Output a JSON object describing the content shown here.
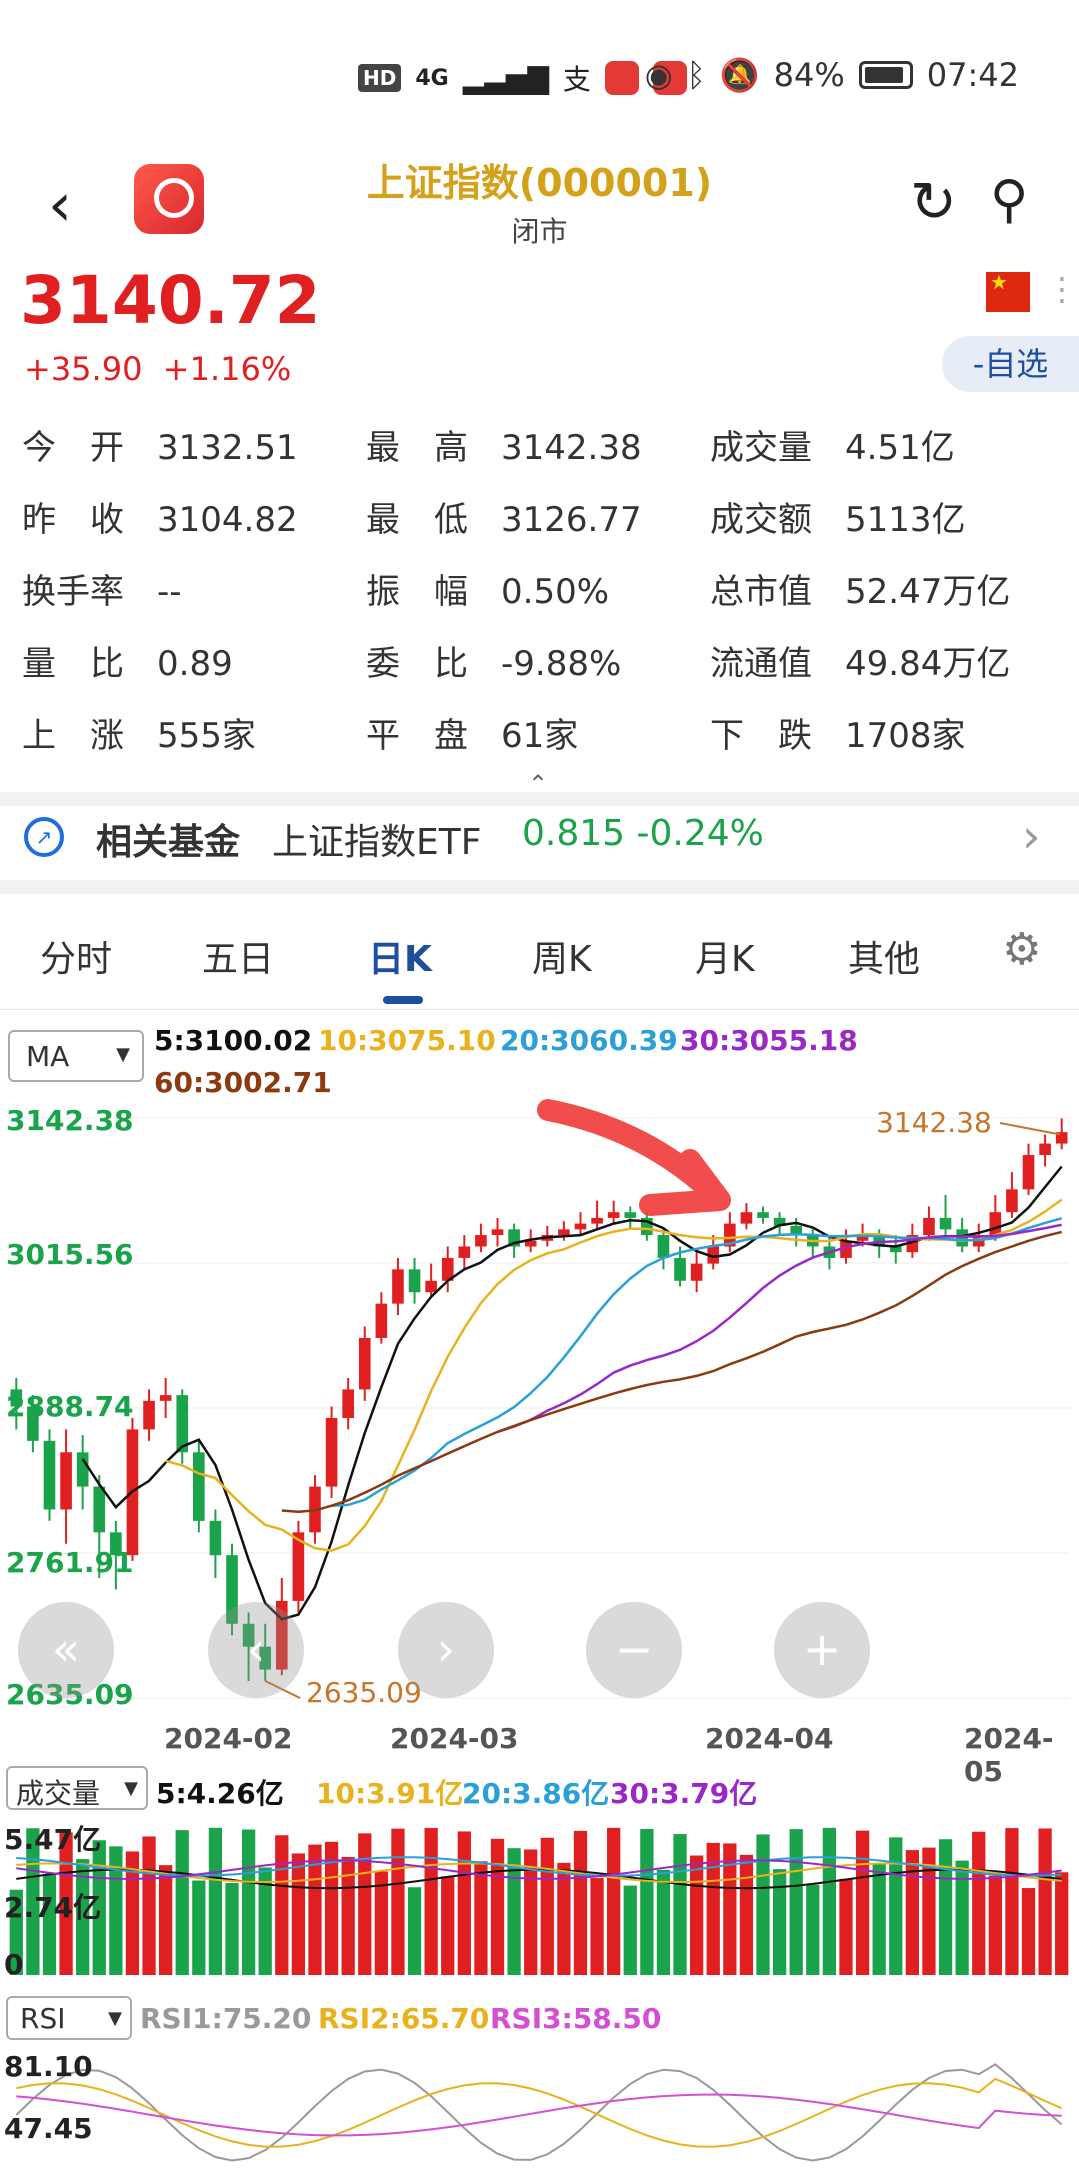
{
  "status_bar": {
    "hd": "HD",
    "network": "4G",
    "pay_icon": "支",
    "battery": "84%",
    "time": "07:42"
  },
  "header": {
    "title": "上证指数(000001)",
    "subtitle": "闭市"
  },
  "price": {
    "last": "3140.72",
    "change": "+35.90",
    "change_pct": "+1.16%"
  },
  "watch_button": "-自选",
  "quote": [
    [
      {
        "label": "今　开",
        "value": "3132.51"
      },
      {
        "label": "最　高",
        "value": "3142.38"
      },
      {
        "label": "成交量",
        "value": "4.51亿"
      }
    ],
    [
      {
        "label": "昨　收",
        "value": "3104.82"
      },
      {
        "label": "最　低",
        "value": "3126.77"
      },
      {
        "label": "成交额",
        "value": "5113亿"
      }
    ],
    [
      {
        "label": "换手率",
        "value": "--"
      },
      {
        "label": "振　幅",
        "value": "0.50%"
      },
      {
        "label": "总市值",
        "value": "52.47万亿"
      }
    ],
    [
      {
        "label": "量　比",
        "value": "0.89"
      },
      {
        "label": "委　比",
        "value": "-9.88%"
      },
      {
        "label": "流通值",
        "value": "49.84万亿"
      }
    ],
    [
      {
        "label": "上　涨",
        "value": "555家"
      },
      {
        "label": "平　盘",
        "value": "61家"
      },
      {
        "label": "下　跌",
        "value": "1708家"
      }
    ]
  ],
  "fund": {
    "title": "相关基金",
    "name": "上证指数ETF",
    "value": "0.815 -0.24%"
  },
  "tabs": [
    "分时",
    "五日",
    "日K",
    "周K",
    "月K",
    "其他"
  ],
  "active_tab": 2,
  "ma": {
    "selector": "MA",
    "ma5": "5:3100.02",
    "ma10": "10:3075.10",
    "ma20": "20:3060.39",
    "ma30": "30:3055.18",
    "ma60": "60:3002.71"
  },
  "volume": {
    "selector": "成交量",
    "ma5": "5:4.26亿",
    "ma10": "10:3.91亿",
    "ma20": "20:3.86亿",
    "ma30": "30:3.79亿",
    "y_labels": [
      "5.47亿",
      "2.74亿",
      "0"
    ]
  },
  "rsi": {
    "selector": "RSI",
    "rsi1": "RSI1:75.20",
    "rsi2": "RSI2:65.70",
    "rsi3": "RSI3:58.50",
    "y_labels": [
      "81.10",
      "47.45"
    ]
  },
  "colors": {
    "up": "#e02020",
    "down": "#1aa34a",
    "ma5": "#111111",
    "ma10": "#e8b21e",
    "ma20": "#2a9fd8",
    "ma30": "#9b27c9",
    "ma60": "#8b3a10"
  },
  "chart_data": {
    "type": "candlestick",
    "y_labels": [
      "3142.38",
      "3015.56",
      "2888.74",
      "2761.91",
      "2635.09"
    ],
    "x_labels": [
      "2024-02",
      "2024-03",
      "2024-04",
      "2024-05"
    ],
    "ylim": [
      2635.09,
      3142.38
    ],
    "high_annotation": "3142.38",
    "low_annotation": "2635.09",
    "candles": [
      [
        2905,
        2890,
        2915,
        2870
      ],
      [
        2890,
        2860,
        2900,
        2850
      ],
      [
        2860,
        2800,
        2870,
        2790
      ],
      [
        2800,
        2850,
        2870,
        2770
      ],
      [
        2850,
        2820,
        2865,
        2800
      ],
      [
        2820,
        2780,
        2830,
        2740
      ],
      [
        2780,
        2760,
        2790,
        2730
      ],
      [
        2760,
        2870,
        2880,
        2755
      ],
      [
        2870,
        2895,
        2905,
        2860
      ],
      [
        2895,
        2900,
        2915,
        2880
      ],
      [
        2900,
        2850,
        2905,
        2840
      ],
      [
        2850,
        2790,
        2860,
        2780
      ],
      [
        2790,
        2760,
        2800,
        2740
      ],
      [
        2760,
        2700,
        2770,
        2690
      ],
      [
        2700,
        2680,
        2710,
        2650
      ],
      [
        2680,
        2660,
        2700,
        2650
      ],
      [
        2660,
        2720,
        2740,
        2655
      ],
      [
        2720,
        2780,
        2790,
        2710
      ],
      [
        2780,
        2820,
        2830,
        2770
      ],
      [
        2820,
        2880,
        2890,
        2810
      ],
      [
        2880,
        2905,
        2915,
        2870
      ],
      [
        2905,
        2950,
        2960,
        2895
      ],
      [
        2950,
        2980,
        2990,
        2945
      ],
      [
        2980,
        3010,
        3020,
        2970
      ],
      [
        3010,
        2990,
        3020,
        2980
      ],
      [
        2990,
        3000,
        3015,
        2985
      ],
      [
        3000,
        3020,
        3030,
        2990
      ],
      [
        3020,
        3030,
        3040,
        3010
      ],
      [
        3030,
        3040,
        3050,
        3025
      ],
      [
        3040,
        3045,
        3055,
        3030
      ],
      [
        3045,
        3030,
        3050,
        3020
      ],
      [
        3030,
        3035,
        3045,
        3025
      ],
      [
        3035,
        3040,
        3048,
        3030
      ],
      [
        3040,
        3045,
        3052,
        3035
      ],
      [
        3045,
        3050,
        3060,
        3040
      ],
      [
        3050,
        3055,
        3070,
        3045
      ],
      [
        3055,
        3060,
        3070,
        3050
      ],
      [
        3060,
        3055,
        3065,
        3045
      ],
      [
        3055,
        3040,
        3060,
        3035
      ],
      [
        3040,
        3020,
        3045,
        3010
      ],
      [
        3020,
        3000,
        3030,
        2995
      ],
      [
        3000,
        3015,
        3025,
        2990
      ],
      [
        3015,
        3030,
        3040,
        3010
      ],
      [
        3030,
        3050,
        3060,
        3025
      ],
      [
        3050,
        3060,
        3068,
        3045
      ],
      [
        3060,
        3055,
        3065,
        3050
      ],
      [
        3055,
        3048,
        3060,
        3040
      ],
      [
        3048,
        3040,
        3055,
        3030
      ],
      [
        3040,
        3030,
        3045,
        3020
      ],
      [
        3030,
        3020,
        3040,
        3010
      ],
      [
        3020,
        3035,
        3045,
        3015
      ],
      [
        3035,
        3040,
        3050,
        3030
      ],
      [
        3040,
        3030,
        3045,
        3020
      ],
      [
        3030,
        3025,
        3040,
        3015
      ],
      [
        3025,
        3040,
        3050,
        3020
      ],
      [
        3040,
        3055,
        3065,
        3035
      ],
      [
        3055,
        3045,
        3075,
        3040
      ],
      [
        3045,
        3030,
        3055,
        3025
      ],
      [
        3030,
        3040,
        3050,
        3025
      ],
      [
        3040,
        3060,
        3075,
        3035
      ],
      [
        3060,
        3080,
        3095,
        3055
      ],
      [
        3080,
        3110,
        3120,
        3075
      ],
      [
        3110,
        3120,
        3128,
        3100
      ],
      [
        3120,
        3130,
        3142,
        3115
      ]
    ]
  }
}
